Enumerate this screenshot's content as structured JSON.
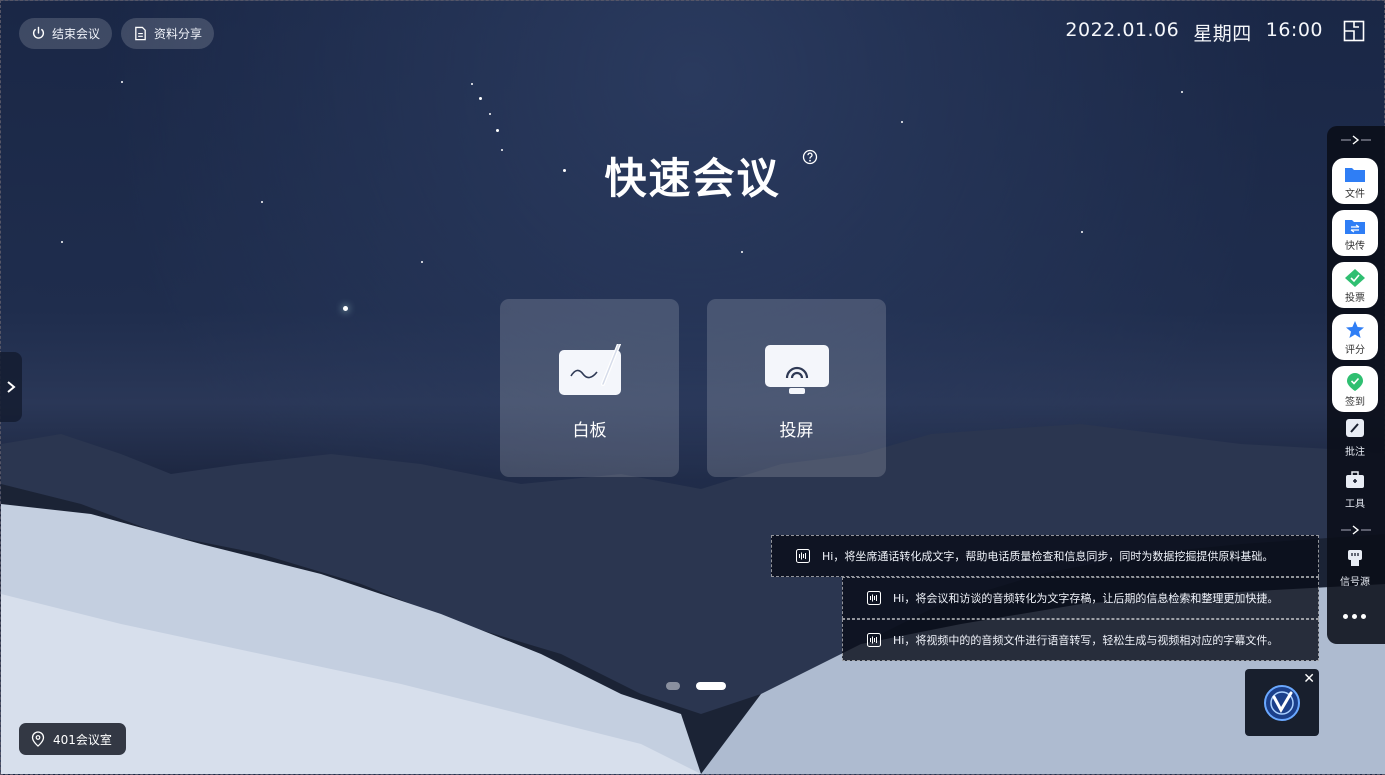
{
  "header": {
    "end_meeting_label": "结束会议",
    "share_material_label": "资料分享",
    "date": "2022.01.06",
    "weekday": "星期四",
    "time": "16:00"
  },
  "main": {
    "title": "快速会议",
    "cards": [
      {
        "label": "白板",
        "icon": "whiteboard-icon"
      },
      {
        "label": "投屏",
        "icon": "screen-cast-icon"
      }
    ]
  },
  "sidebar": {
    "items": [
      {
        "label": "文件",
        "icon": "folder-icon"
      },
      {
        "label": "快传",
        "icon": "transfer-folder-icon"
      },
      {
        "label": "投票",
        "icon": "vote-icon"
      },
      {
        "label": "评分",
        "icon": "star-icon"
      },
      {
        "label": "签到",
        "icon": "check-in-icon"
      },
      {
        "label": "批注",
        "icon": "annotate-icon"
      },
      {
        "label": "工具",
        "icon": "toolbox-icon"
      },
      {
        "label": "信号源",
        "icon": "signal-source-icon"
      }
    ]
  },
  "tips": [
    "Hi，将坐席通话转化成文字，帮助电话质量检查和信息同步，同时为数据挖掘提供原料基础。",
    "Hi，将会议和访谈的音频转化为文字存稿，让后期的信息检索和整理更加快捷。",
    "Hi，将视频中的的音频文件进行语音转写，轻松生成与视频相对应的字幕文件。"
  ],
  "pagination": {
    "current": 2,
    "total": 2
  },
  "location": {
    "room": "401会议室"
  },
  "colors": {
    "accent": "#2f7ef5",
    "green": "#2fbf71"
  }
}
